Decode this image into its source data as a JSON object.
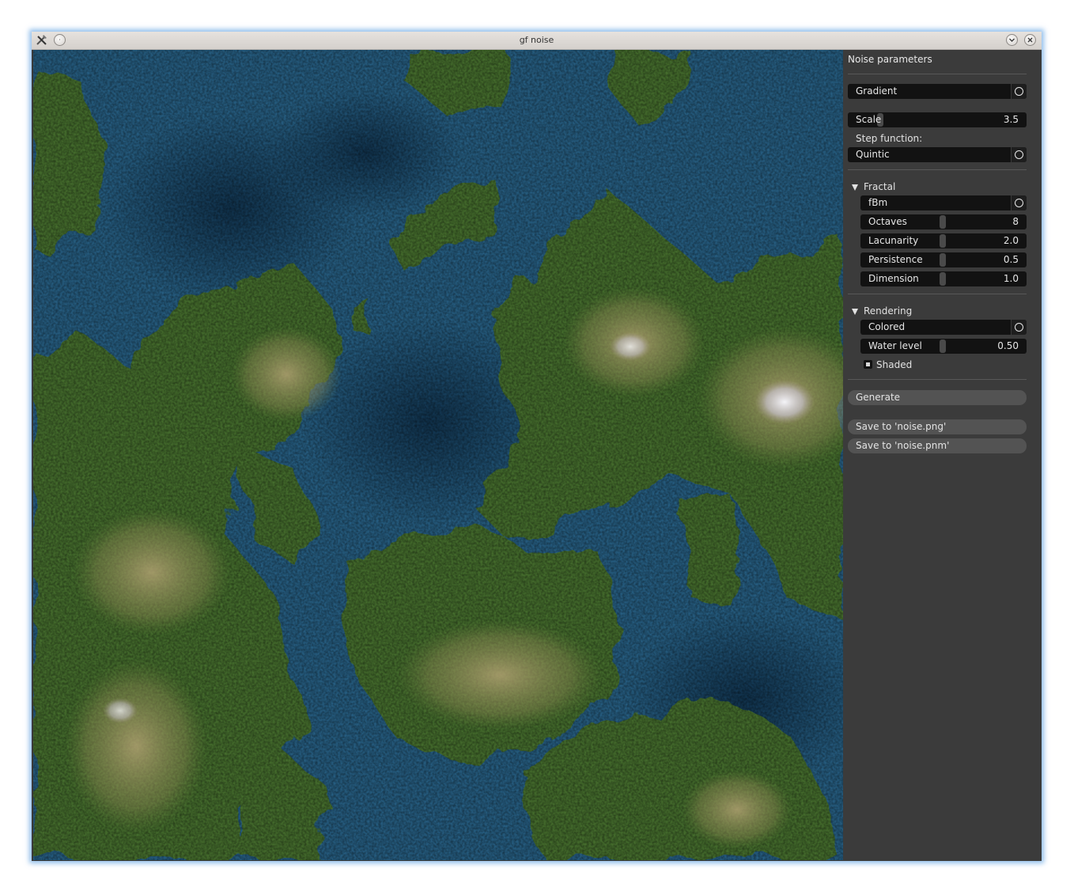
{
  "window": {
    "title": "gf noise",
    "app_icon": "tools-icon",
    "pin_icon": "pin-dot-icon",
    "minimize_icon": "chevron-down-icon",
    "close_icon": "close-x-icon"
  },
  "panel": {
    "title": "Noise parameters",
    "noise_type": {
      "value": "Gradient",
      "icon": "circle-icon"
    },
    "scale": {
      "label": "Scale",
      "value": "3.5",
      "fraction": 0.05
    },
    "step_function": {
      "label": "Step function:",
      "value": "Quintic"
    },
    "fractal": {
      "header": "Fractal",
      "expanded": true,
      "type": "fBm",
      "octaves": {
        "label": "Octaves",
        "value": "8",
        "fraction": 0.5
      },
      "lacunarity": {
        "label": "Lacunarity",
        "value": "2.0",
        "fraction": 0.5
      },
      "persistence": {
        "label": "Persistence",
        "value": "0.5",
        "fraction": 0.5
      },
      "dimension": {
        "label": "Dimension",
        "value": "1.0",
        "fraction": 0.5
      }
    },
    "rendering": {
      "header": "Rendering",
      "expanded": true,
      "mode": "Colored",
      "water_level": {
        "label": "Water level",
        "value": "0.50",
        "fraction": 0.5
      },
      "shaded": {
        "label": "Shaded",
        "checked": true
      }
    },
    "buttons": {
      "generate": "Generate",
      "save_png": "Save to 'noise.png'",
      "save_pnm": "Save to 'noise.pnm'"
    }
  },
  "colors": {
    "deep_water": "#113a57",
    "shallow_water": "#2d6e96",
    "land": "#4f7a34",
    "highland": "#a69a66",
    "snow": "#e8e8ef",
    "panel_bg": "#3b3b3b",
    "widget_bg": "#121212",
    "button_bg": "#535353"
  }
}
